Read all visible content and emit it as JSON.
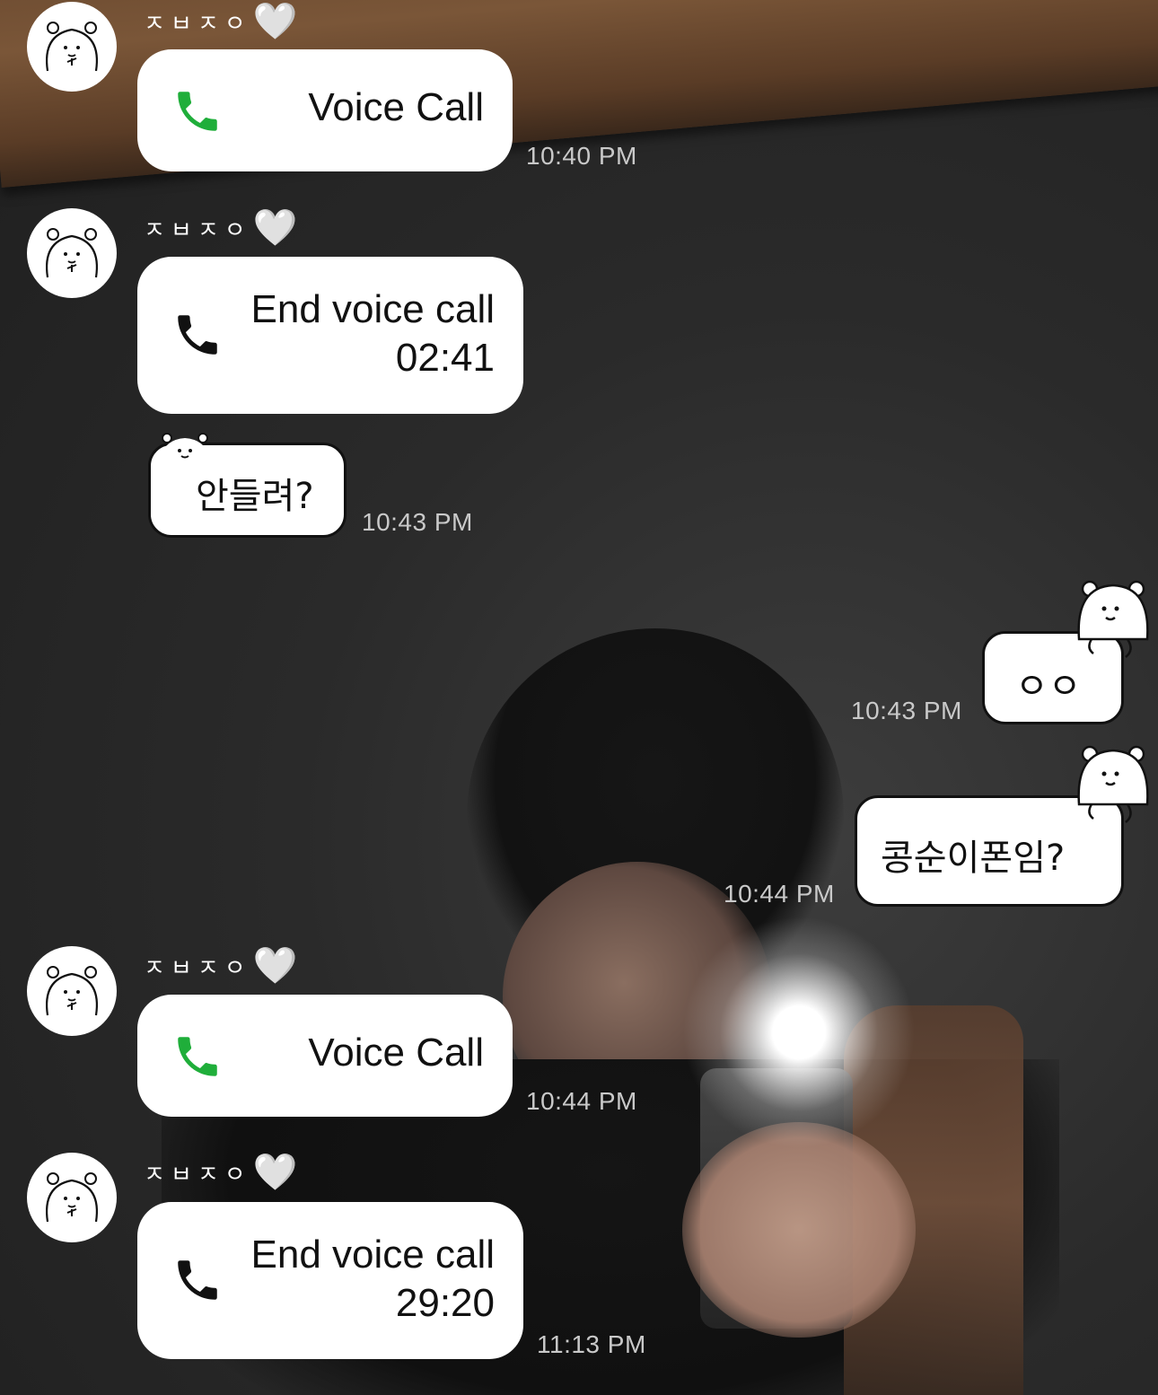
{
  "background": {
    "type": "mirror-selfie-photo"
  },
  "messages": [
    {
      "type": "incoming-call",
      "sender": "ㅈㅂㅈㅇ",
      "heart": "🤍",
      "label": "Voice Call",
      "icon": "phone-icon-green",
      "time": "10:40 PM"
    },
    {
      "type": "incoming-call-end",
      "sender": "ㅈㅂㅈㅇ",
      "heart": "🤍",
      "label": "End voice call",
      "duration": "02:41",
      "icon": "phone-icon-black"
    },
    {
      "type": "incoming-sticker-text",
      "text": "안들려?",
      "time": "10:43 PM"
    },
    {
      "type": "outgoing-sticker-text",
      "text": "ㅇㅇ",
      "time": "10:43 PM"
    },
    {
      "type": "outgoing-sticker-text",
      "text": "콩순이폰임?",
      "time": "10:44 PM"
    },
    {
      "type": "incoming-call",
      "sender": "ㅈㅂㅈㅇ",
      "heart": "🤍",
      "label": "Voice Call",
      "icon": "phone-icon-green",
      "time": "10:44 PM"
    },
    {
      "type": "incoming-call-end",
      "sender": "ㅈㅂㅈㅇ",
      "heart": "🤍",
      "label": "End voice call",
      "duration": "29:20",
      "icon": "phone-icon-black",
      "time": "11:13 PM"
    }
  ],
  "colors": {
    "call_green": "#1fae3a",
    "bubble_bg": "#ffffff",
    "timestamp": "#c9c9c9"
  }
}
